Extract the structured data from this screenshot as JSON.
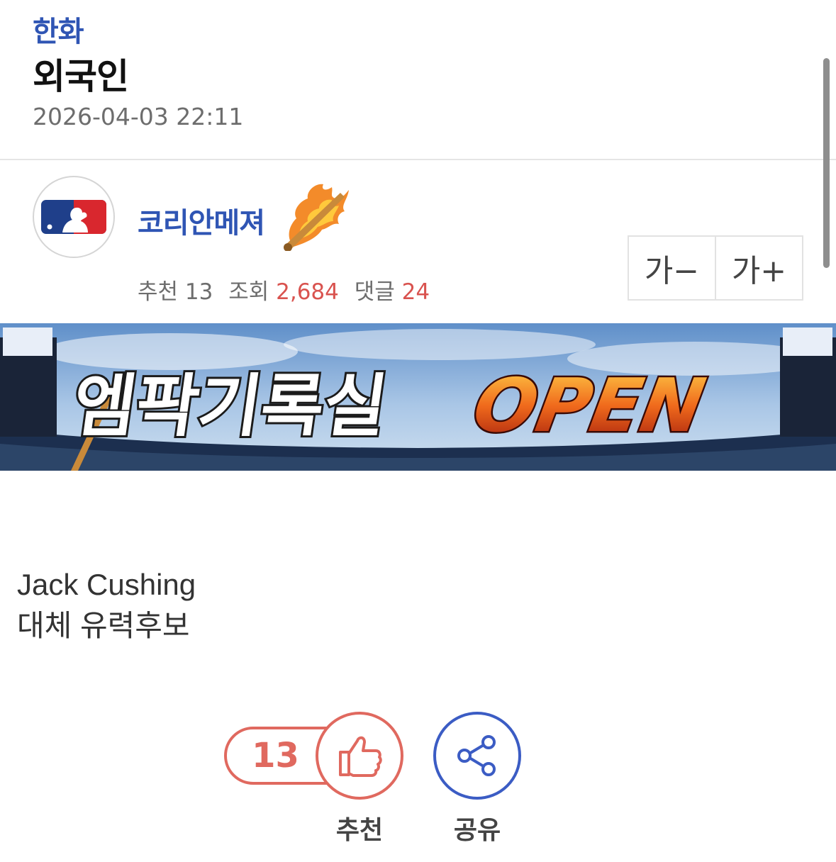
{
  "post": {
    "category": "한화",
    "title": "외국인",
    "date": "2026-04-03 22:11"
  },
  "author": {
    "nickname": "코리안메져",
    "avatar_icon": "mlb-logo-icon",
    "rank_icon": "flaming-bat-icon"
  },
  "stats": {
    "recommend_label": "추천",
    "recommend_count": "13",
    "views_label": "조회",
    "views_count": "2,684",
    "comments_label": "댓글",
    "comments_count": "24"
  },
  "font_controls": {
    "decrease": "가−",
    "increase": "가+"
  },
  "banner": {
    "korean_text": "엠팍기록실",
    "open_text": "OPEN"
  },
  "content": {
    "line1": "Jack Cushing",
    "line2": "대체 유력후보"
  },
  "actions": {
    "recommend_count": "13",
    "recommend_label": "추천",
    "share_label": "공유"
  },
  "colors": {
    "accent_blue": "#2f55b4",
    "accent_red": "#e0695f",
    "share_blue": "#3b5cc4"
  }
}
